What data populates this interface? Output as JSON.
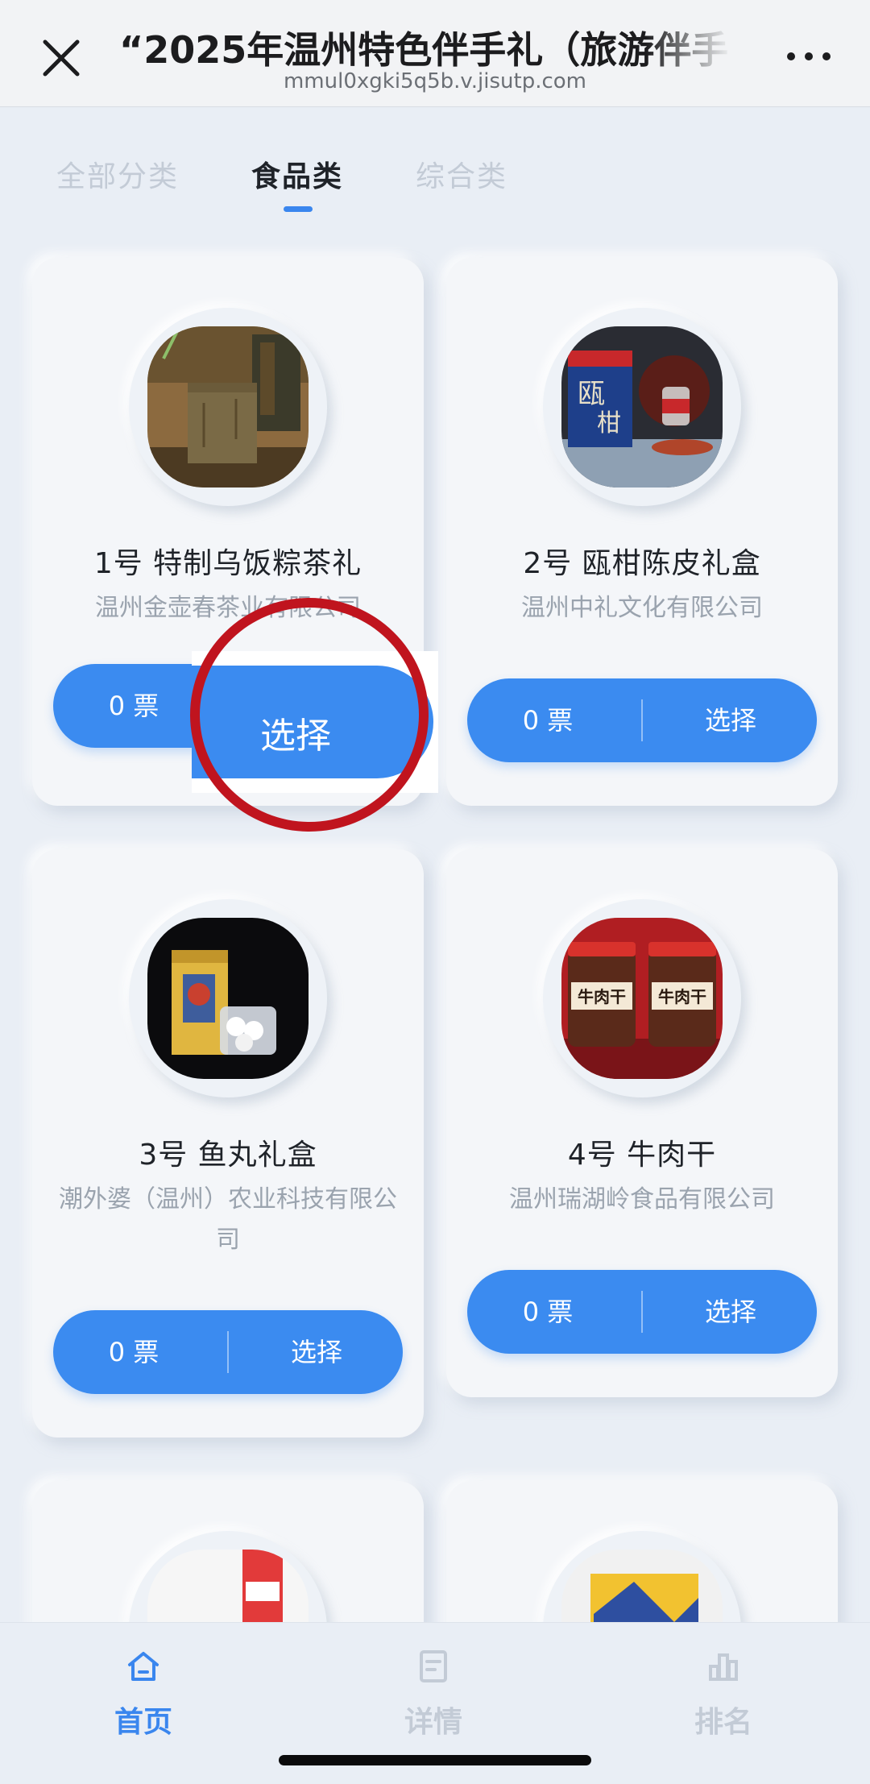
{
  "header": {
    "title": "“2025年温州特色伴手礼（旅游伴手",
    "url": "mmul0xgki5q5b.v.jisutp.com"
  },
  "tabs": [
    {
      "label": "全部分类",
      "active": false
    },
    {
      "label": "食品类",
      "active": true
    },
    {
      "label": "综合类",
      "active": false
    }
  ],
  "items": [
    {
      "title": "1号   特制乌饭粽茶礼",
      "company": "温州金壶春茶业有限公司",
      "votes": "0 票",
      "select_label": "选择",
      "image": "tea-gift-box"
    },
    {
      "title": "2号   瓯柑陈皮礼盒",
      "company": "温州中礼文化有限公司",
      "votes": "0 票",
      "select_label": "选择",
      "image": "tangerine-peel-gift-box"
    },
    {
      "title": "3号   鱼丸礼盒",
      "company": "潮外婆（温州）农业科技有限公司",
      "votes": "0 票",
      "select_label": "选择",
      "image": "fish-ball-gift-box"
    },
    {
      "title": "4号   牛肉干",
      "company": "温州瑞湖岭食品有限公司",
      "votes": "0 票",
      "select_label": "选择",
      "image": "beef-jerky-jars",
      "jar_label": "牛肉干"
    }
  ],
  "zoom_overlay": {
    "label": "选择"
  },
  "bottom_nav": [
    {
      "label": "首页",
      "icon": "home-icon",
      "active": true
    },
    {
      "label": "详情",
      "icon": "document-icon",
      "active": false
    },
    {
      "label": "排名",
      "icon": "bar-chart-icon",
      "active": false
    }
  ],
  "colors": {
    "accent": "#3b8bf0",
    "annotation": "#c0141e",
    "background": "#e9eef5"
  }
}
